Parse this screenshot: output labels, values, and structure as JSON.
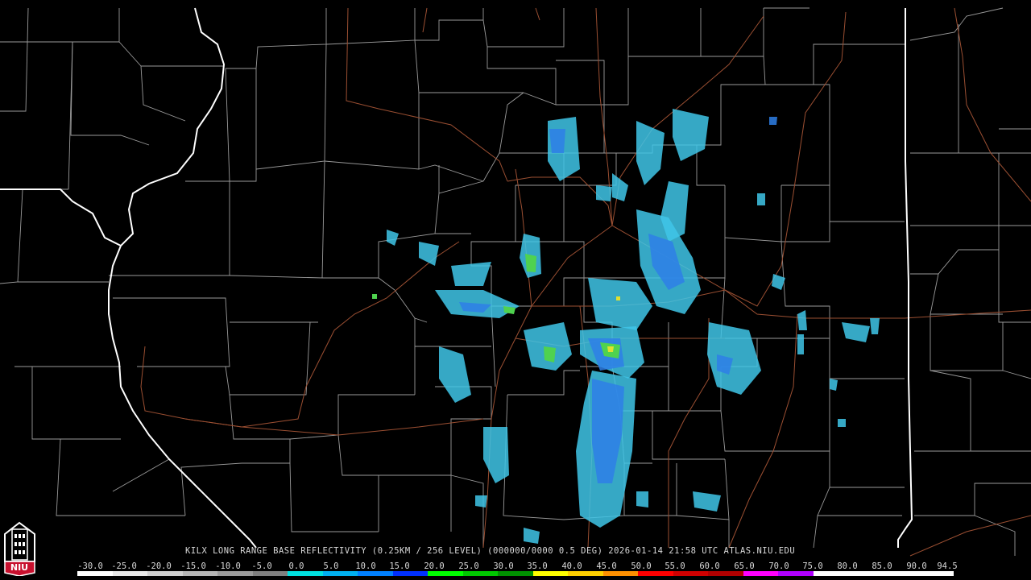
{
  "caption": "KILX LONG RANGE BASE REFLECTIVITY (0.25KM / 256 LEVEL) (000000/0000 0.5 DEG) 2026-01-14 21:58 UTC  ATLAS.NIU.EDU",
  "legend": {
    "labels": [
      "-30.0",
      "-25.0",
      "-20.0",
      "-15.0",
      "-10.0",
      "-5.0",
      "0.0",
      "5.0",
      "10.0",
      "15.0",
      "20.0",
      "25.0",
      "30.0",
      "35.0",
      "40.0",
      "45.0",
      "50.0",
      "55.0",
      "60.0",
      "65.0",
      "70.0",
      "75.0",
      "80.0",
      "85.0",
      "90.0",
      "94.5"
    ],
    "colors": [
      "#ffffff",
      "#e8e8e8",
      "#cfcfcf",
      "#b5b5b5",
      "#9a9a9a",
      "#7f7f7f",
      "#00e0e0",
      "#00b0f0",
      "#0080ff",
      "#0030ff",
      "#00ff00",
      "#00c800",
      "#009000",
      "#ffff00",
      "#ffd000",
      "#ff9000",
      "#ff0000",
      "#d00000",
      "#b00000",
      "#ff00ff",
      "#b000ff",
      "#ffffff",
      "#ffffff",
      "#ffffff",
      "#ffffff"
    ]
  },
  "logo": {
    "text": "NIU",
    "icon": "university-tower-icon",
    "colors": {
      "shield": "#c8102e",
      "frame": "#ffffff"
    }
  },
  "map": {
    "colors": {
      "state_border": "#ffffff",
      "county_border": "#9a9a9a",
      "highway": "#9b4f32",
      "echo_light": "#3fc6e8",
      "echo_medium": "#2e7fe6",
      "echo_strong": "#4fd24f",
      "echo_peak": "#e0e030"
    }
  }
}
